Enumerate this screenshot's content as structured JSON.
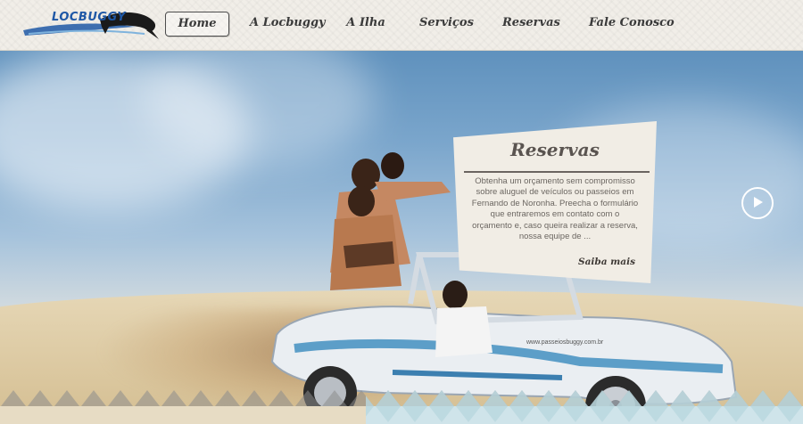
{
  "header": {
    "logo_text": "LOCBUGGY",
    "nav": [
      {
        "label": "Home",
        "active": true
      },
      {
        "label": "A Locbuggy",
        "active": false
      },
      {
        "label": "A Ilha",
        "active": false
      },
      {
        "label": "Serviços",
        "active": false
      },
      {
        "label": "Reservas",
        "active": false
      },
      {
        "label": "Fale Conosco",
        "active": false
      }
    ]
  },
  "hero": {
    "card": {
      "title": "Reservas",
      "body": "Obtenha um orçamento sem compromisso sobre aluguel de veículos ou passeios em Fernando de Noronha. Preecha o formulário que entraremos em contato com o orçamento e, caso queira realizar a reserva, nossa equipe de ...",
      "more_label": "Saiba mais"
    },
    "play_icon": "play-icon",
    "buggy_text": "www.passeiosbuggy.com.br"
  },
  "colors": {
    "brand_blue": "#1f58a6",
    "card_bg": "#f1ede5",
    "nav_text": "#3a3a3a",
    "diamond_gray": "#8c8c8c",
    "diamond_teal": "#b9d8df"
  }
}
